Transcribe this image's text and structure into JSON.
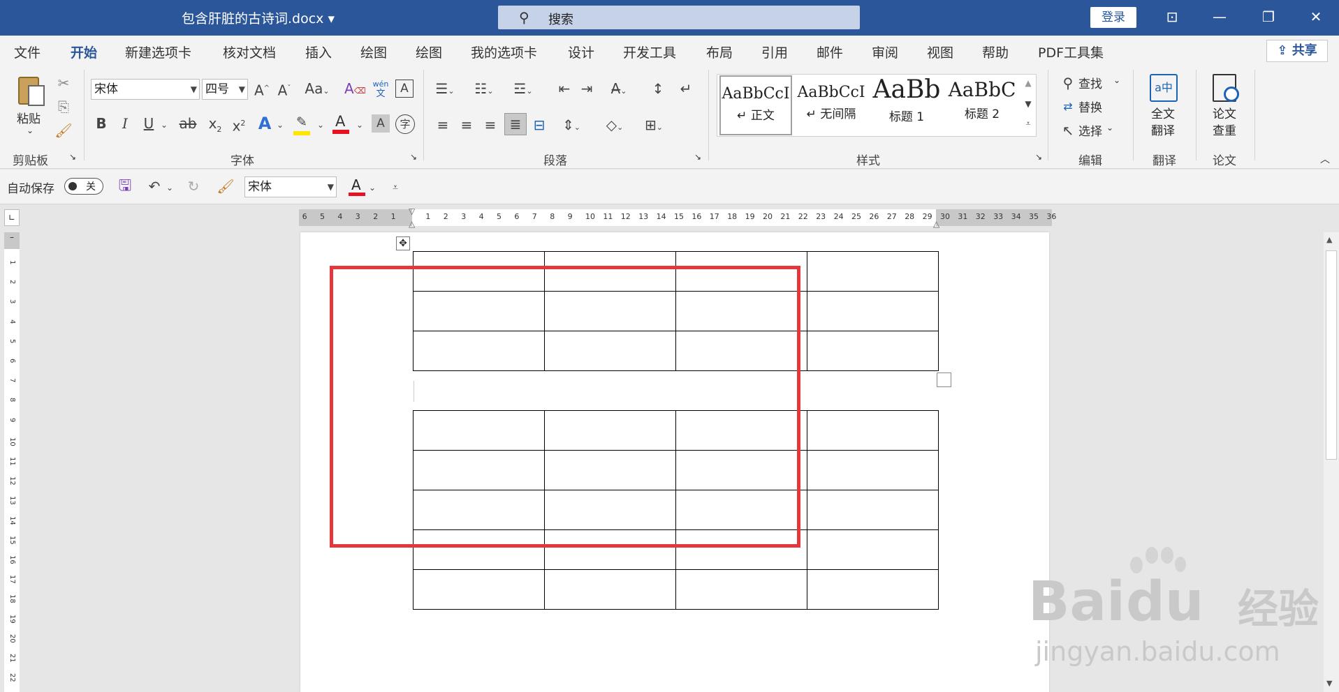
{
  "window": {
    "doc_title": "包含肝脏的古诗词.docx",
    "search_placeholder": "搜索",
    "login_label": "登录"
  },
  "tabs": [
    "文件",
    "开始",
    "新建选项卡",
    "核对文档",
    "插入",
    "绘图",
    "绘图",
    "我的选项卡",
    "设计",
    "开发工具",
    "布局",
    "引用",
    "邮件",
    "审阅",
    "视图",
    "帮助",
    "PDF工具集"
  ],
  "active_tab": "开始",
  "share_label": "共享",
  "ribbon": {
    "clipboard": {
      "paste_label": "粘贴",
      "group_label": "剪贴板"
    },
    "font": {
      "font_name": "宋体",
      "font_size": "四号",
      "group_label": "字体",
      "pinyin_top": "wén",
      "pinyin_bottom": "文"
    },
    "paragraph": {
      "group_label": "段落"
    },
    "styles": {
      "group_label": "样式",
      "items": [
        {
          "preview": "AaBbCcI",
          "name": "↵ 正文"
        },
        {
          "preview": "AaBbCcI",
          "name": "↵ 无间隔"
        },
        {
          "preview": "AaBb",
          "name": "标题 1"
        },
        {
          "preview": "AaBbC",
          "name": "标题 2"
        }
      ]
    },
    "editing": {
      "find": "查找",
      "replace": "替换",
      "select": "选择",
      "group_label": "编辑"
    },
    "translate": {
      "label_line1": "全文",
      "label_line2": "翻译",
      "group_label": "翻译"
    },
    "paper": {
      "label_line1": "论文",
      "label_line2": "查重",
      "group_label": "论文"
    }
  },
  "qat": {
    "autosave_label": "自动保存",
    "autosave_state": "关",
    "font_name": "宋体"
  },
  "ruler": {
    "left_numbers": [
      "6",
      "5",
      "4",
      "3",
      "2",
      "1"
    ],
    "right_numbers": [
      "1",
      "2",
      "3",
      "4",
      "5",
      "6",
      "7",
      "8",
      "9",
      "10",
      "11",
      "12",
      "13",
      "14",
      "15",
      "16",
      "17",
      "18",
      "19",
      "20",
      "21",
      "22",
      "23",
      "24",
      "25",
      "26",
      "27",
      "28",
      "29",
      "30",
      "31",
      "32",
      "33",
      "34",
      "35",
      "36"
    ],
    "vertical_numbers": [
      "1",
      "2",
      "3",
      "4",
      "5",
      "6",
      "7",
      "8",
      "9",
      "10",
      "11",
      "12",
      "13",
      "14",
      "15",
      "16",
      "17",
      "18",
      "19",
      "20",
      "21",
      "22"
    ]
  },
  "document": {
    "table1": {
      "rows": 3,
      "cols": 4
    },
    "table2": {
      "rows": 5,
      "cols": 4
    }
  },
  "watermark": {
    "brand": "Bai",
    "brand2": "du",
    "cn": "经验",
    "url": "jingyan.baidu.com"
  },
  "colors": {
    "title_bar": "#2b579a",
    "highlight_box": "#e4363b",
    "highlight_yellow": "#ffe600",
    "font_red": "#e81123"
  }
}
